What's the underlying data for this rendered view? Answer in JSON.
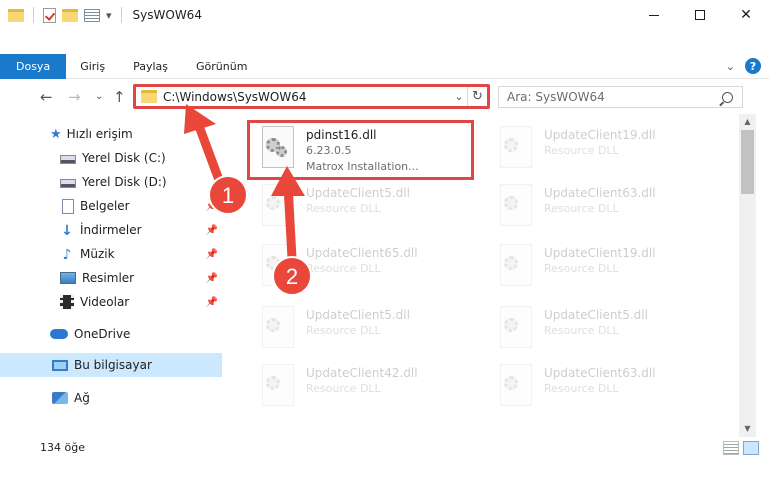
{
  "window": {
    "title": "SysWOW64"
  },
  "ribbon": {
    "tabs": [
      {
        "label": "Dosya",
        "active": true
      },
      {
        "label": "Giriş",
        "active": false
      },
      {
        "label": "Paylaş",
        "active": false
      },
      {
        "label": "Görünüm",
        "active": false
      }
    ],
    "help_label": "?"
  },
  "address": {
    "path": "C:\\Windows\\SysWOW64",
    "search_placeholder": "Ara: SysWOW64"
  },
  "sidebar": {
    "items": [
      {
        "label": "Hızlı erişim",
        "icon": "star-icon"
      },
      {
        "label": "Yerel Disk (C:)",
        "icon": "disk-icon"
      },
      {
        "label": "Yerel Disk (D:)",
        "icon": "disk-icon"
      },
      {
        "label": "Belgeler",
        "icon": "document-icon",
        "pinned": true
      },
      {
        "label": "İndirmeler",
        "icon": "download-icon",
        "pinned": true
      },
      {
        "label": "Müzik",
        "icon": "music-icon",
        "pinned": true
      },
      {
        "label": "Resimler",
        "icon": "pictures-icon",
        "pinned": true
      },
      {
        "label": "Videolar",
        "icon": "videos-icon",
        "pinned": true
      },
      {
        "label": "OneDrive",
        "icon": "onedrive-icon"
      },
      {
        "label": "Bu bilgisayar",
        "icon": "this-pc-icon",
        "selected": true
      },
      {
        "label": "Ağ",
        "icon": "network-icon"
      }
    ]
  },
  "files": {
    "highlighted": {
      "name": "pdinst16.dll",
      "version": "6.23.0.5",
      "company": "Matrox Installation..."
    },
    "others": [
      {
        "name": "UpdateClient19.dll",
        "type": "Resource DLL"
      },
      {
        "name": "UpdateClient5.dll",
        "type": "Resource DLL"
      },
      {
        "name": "UpdateClient63.dll",
        "type": "Resource DLL"
      },
      {
        "name": "UpdateClient65.dll",
        "type": "Resource DLL"
      },
      {
        "name": "UpdateClient19.dll",
        "type": "Resource DLL"
      },
      {
        "name": "UpdateClient5.dll",
        "type": "Resource DLL"
      },
      {
        "name": "UpdateClient5.dll",
        "type": "Resource DLL"
      },
      {
        "name": "UpdateClient42.dll",
        "type": "Resource DLL"
      },
      {
        "name": "UpdateClient63.dll",
        "type": "Resource DLL"
      }
    ]
  },
  "status": {
    "count": "134 öğe"
  },
  "annotations": {
    "step1": "1",
    "step2": "2",
    "color": "#e8473a"
  }
}
